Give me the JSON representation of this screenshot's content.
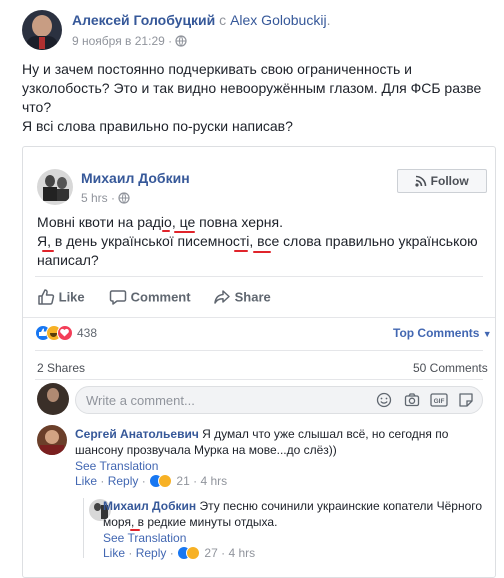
{
  "post": {
    "author": "Алексей Голобуцкий",
    "connector": "с",
    "with": "Alex Golobuckij",
    "date": "9 ноября в 21:29 ·",
    "text_lines": [
      "Ну и зачем постоянно подчеркивать свою ограниченность и",
      "узколобость? Это и так видно невооружённым глазом. Для ФСБ разве",
      "что?",
      "Я всі слова правильно по-руски написав?"
    ]
  },
  "shared": {
    "author": "Михаил Добкин",
    "time": "5 hrs ·",
    "follow_label": "Follow",
    "line1": "Мовні квоти на радіо, це повна херня.",
    "line2": "Я, в день української писемності, все слова правильно українською",
    "line3": "написал?",
    "actions": {
      "like": "Like",
      "comment": "Comment",
      "share": "Share"
    },
    "reaction_count": "438",
    "top_comments": "Top Comments",
    "shares": "2 Shares",
    "comments_count": "50 Comments",
    "write_placeholder": "Write a comment...",
    "comments": [
      {
        "author": "Сергей Анатольевич",
        "text_line1": "Я думал что уже слышал всё, но сегодня по",
        "text_line2": "шансону прозвучала Мурка на мове...до слёз))",
        "see_translation": "See Translation",
        "like": "Like",
        "reply": "Reply",
        "count": "21",
        "time": "4 hrs"
      },
      {
        "author": "Михаил Добкин",
        "text_line1": "Эту песню сочинили украинские копатели Чёрного",
        "text_line2": "моря, в редкие минуты отдыха.",
        "see_translation": "See Translation",
        "like": "Like",
        "reply": "Reply",
        "count": "27",
        "time": "4 hrs"
      }
    ]
  },
  "colors": {
    "link": "#365899",
    "accent": "#4267b2",
    "muted": "#90949c",
    "underline": "#e0242b"
  }
}
